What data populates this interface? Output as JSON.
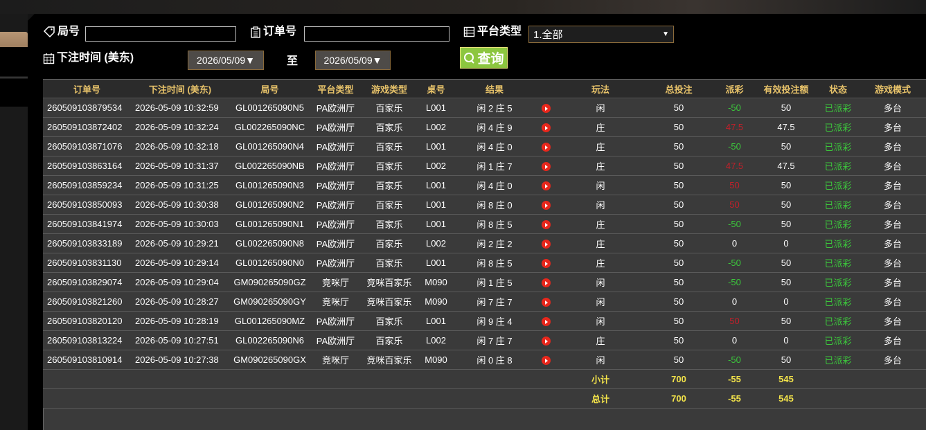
{
  "filters": {
    "round_label": "局号",
    "order_label": "订单号",
    "platform_label": "平台类型",
    "platform_value": "1.全部",
    "time_label": "下注时间 (美东)",
    "date_from": "2026/05/09▼",
    "to_label": "至",
    "date_to": "2026/05/09▼",
    "query_label": "查询"
  },
  "table": {
    "headers": [
      "订单号",
      "下注时间 (美东)",
      "局号",
      "平台类型",
      "游戏类型",
      "桌号",
      "结果",
      "",
      "玩法",
      "总投注",
      "派彩",
      "有效投注额",
      "状态",
      "游戏模式"
    ],
    "rows": [
      [
        "260509103879534",
        "2026-05-09 10:32:59",
        "GL001265090N5",
        "PA欧洲厅",
        "百家乐",
        "L001",
        "闲 2 庄 5",
        "闲",
        "50",
        "-50",
        "50",
        "已派彩",
        "多台"
      ],
      [
        "260509103872402",
        "2026-05-09 10:32:24",
        "GL002265090NC",
        "PA欧洲厅",
        "百家乐",
        "L002",
        "闲 4 庄 9",
        "庄",
        "50",
        "47.5",
        "47.5",
        "已派彩",
        "多台"
      ],
      [
        "260509103871076",
        "2026-05-09 10:32:18",
        "GL001265090N4",
        "PA欧洲厅",
        "百家乐",
        "L001",
        "闲 4 庄 0",
        "庄",
        "50",
        "-50",
        "50",
        "已派彩",
        "多台"
      ],
      [
        "260509103863164",
        "2026-05-09 10:31:37",
        "GL002265090NB",
        "PA欧洲厅",
        "百家乐",
        "L002",
        "闲 1 庄 7",
        "庄",
        "50",
        "47.5",
        "47.5",
        "已派彩",
        "多台"
      ],
      [
        "260509103859234",
        "2026-05-09 10:31:25",
        "GL001265090N3",
        "PA欧洲厅",
        "百家乐",
        "L001",
        "闲 4 庄 0",
        "闲",
        "50",
        "50",
        "50",
        "已派彩",
        "多台"
      ],
      [
        "260509103850093",
        "2026-05-09 10:30:38",
        "GL001265090N2",
        "PA欧洲厅",
        "百家乐",
        "L001",
        "闲 8 庄 0",
        "闲",
        "50",
        "50",
        "50",
        "已派彩",
        "多台"
      ],
      [
        "260509103841974",
        "2026-05-09 10:30:03",
        "GL001265090N1",
        "PA欧洲厅",
        "百家乐",
        "L001",
        "闲 8 庄 5",
        "庄",
        "50",
        "-50",
        "50",
        "已派彩",
        "多台"
      ],
      [
        "260509103833189",
        "2026-05-09 10:29:21",
        "GL002265090N8",
        "PA欧洲厅",
        "百家乐",
        "L002",
        "闲 2 庄 2",
        "庄",
        "50",
        "0",
        "0",
        "已派彩",
        "多台"
      ],
      [
        "260509103831130",
        "2026-05-09 10:29:14",
        "GL001265090N0",
        "PA欧洲厅",
        "百家乐",
        "L001",
        "闲 8 庄 5",
        "庄",
        "50",
        "-50",
        "50",
        "已派彩",
        "多台"
      ],
      [
        "260509103829074",
        "2026-05-09 10:29:04",
        "GM090265090GZ",
        "竞咪厅",
        "竞咪百家乐",
        "M090",
        "闲 1 庄 5",
        "闲",
        "50",
        "-50",
        "50",
        "已派彩",
        "多台"
      ],
      [
        "260509103821260",
        "2026-05-09 10:28:27",
        "GM090265090GY",
        "竞咪厅",
        "竞咪百家乐",
        "M090",
        "闲 7 庄 7",
        "闲",
        "50",
        "0",
        "0",
        "已派彩",
        "多台"
      ],
      [
        "260509103820120",
        "2026-05-09 10:28:19",
        "GL001265090MZ",
        "PA欧洲厅",
        "百家乐",
        "L001",
        "闲 9 庄 4",
        "闲",
        "50",
        "50",
        "50",
        "已派彩",
        "多台"
      ],
      [
        "260509103813224",
        "2026-05-09 10:27:51",
        "GL002265090N6",
        "PA欧洲厅",
        "百家乐",
        "L002",
        "闲 7 庄 7",
        "庄",
        "50",
        "0",
        "0",
        "已派彩",
        "多台"
      ],
      [
        "260509103810914",
        "2026-05-09 10:27:38",
        "GM090265090GX",
        "竞咪厅",
        "竞咪百家乐",
        "M090",
        "闲 0 庄 8",
        "闲",
        "50",
        "-50",
        "50",
        "已派彩",
        "多台"
      ]
    ],
    "subtotal": {
      "label": "小计",
      "total_bet": "700",
      "payout": "-55",
      "valid_bet": "545"
    },
    "total": {
      "label": "总计",
      "total_bet": "700",
      "payout": "-55",
      "valid_bet": "545"
    }
  },
  "colors": {
    "header_text": "#e8c36a",
    "payout_negative": "#3cc83c",
    "payout_positive": "#c0202a",
    "status": "#3cc83c",
    "summary_text": "#f3e34a",
    "accent": "#8cc63f"
  }
}
